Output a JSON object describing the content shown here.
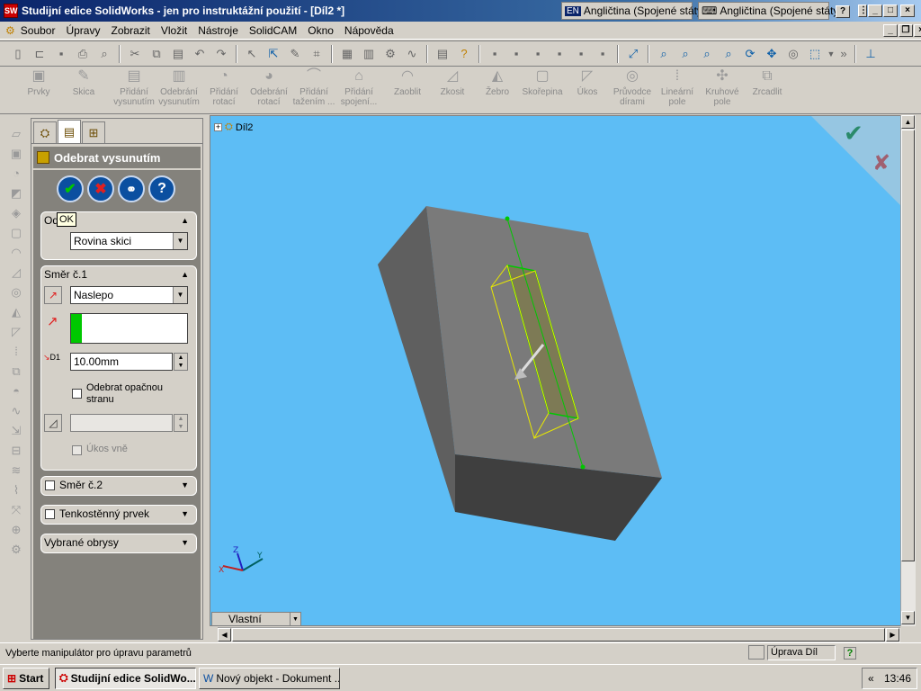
{
  "window": {
    "title": "Studijní edice SolidWorks - jen pro instruktážní použití - [Díl2 *]",
    "ime1": "Angličtina (Spojené státy)",
    "ime1_badge": "EN",
    "ime2": "Angličtina (Spojené státy)",
    "help": "?"
  },
  "menu": [
    "Soubor",
    "Úpravy",
    "Zobrazit",
    "Vložit",
    "Nástroje",
    "SolidCAM",
    "Okno",
    "Nápověda"
  ],
  "features": [
    {
      "l1": "Prvky",
      "l2": "",
      "icon": "▣"
    },
    {
      "l1": "Skica",
      "l2": "",
      "icon": "✎"
    },
    {
      "l1": "Přidání",
      "l2": "vysunutím",
      "icon": "▤"
    },
    {
      "l1": "Odebrání",
      "l2": "vysunutím",
      "icon": "▥"
    },
    {
      "l1": "Přidání",
      "l2": "rotací",
      "icon": "◔"
    },
    {
      "l1": "Odebrání",
      "l2": "rotací",
      "icon": "◕"
    },
    {
      "l1": "Přidání",
      "l2": "tažením ...",
      "icon": "⌒"
    },
    {
      "l1": "Přidání",
      "l2": "spojení...",
      "icon": "⌂"
    },
    {
      "l1": "Zaoblit",
      "l2": "",
      "icon": "◠"
    },
    {
      "l1": "Zkosit",
      "l2": "",
      "icon": "◿"
    },
    {
      "l1": "Žebro",
      "l2": "",
      "icon": "◭"
    },
    {
      "l1": "Skořepina",
      "l2": "",
      "icon": "▢"
    },
    {
      "l1": "Úkos",
      "l2": "",
      "icon": "◸"
    },
    {
      "l1": "Průvodce",
      "l2": "dírami",
      "icon": "◎"
    },
    {
      "l1": "Lineární",
      "l2": "pole",
      "icon": "⁞"
    },
    {
      "l1": "Kruhové",
      "l2": "pole",
      "icon": "✣"
    },
    {
      "l1": "Zrcadlit",
      "l2": "",
      "icon": "⧉"
    }
  ],
  "pm": {
    "title": "Odebrat vysunutím",
    "from_label": "Od",
    "tooltip": "OK",
    "from_value": "Rovina skici",
    "dir1_label": "Směr č.1",
    "dir1_type": "Naslepo",
    "depth": "10.00mm",
    "depth_label": "D1",
    "flip_side": "Odebrat opačnou stranu",
    "draft_outward": "Úkos vně",
    "dir2_label": "Směr č.2",
    "thin_label": "Tenkostěnný prvek",
    "contours_label": "Vybrané obrysy",
    "accent_green": "#00c800"
  },
  "viewport": {
    "tree_item": "Díl2",
    "view_select": "Vlastní",
    "background": "#5dbdf5",
    "axis_x": "X",
    "axis_y": "Y",
    "axis_z": "Z"
  },
  "status": {
    "message": "Vyberte manipulátor pro úpravu parametrů",
    "mode": "Úprava Díl",
    "help": "?"
  },
  "taskbar": {
    "start": "Start",
    "items": [
      "Studijní edice SolidWo...",
      "Nový objekt - Dokument ..."
    ],
    "clock": "13:46",
    "tray_arrow": "«"
  }
}
